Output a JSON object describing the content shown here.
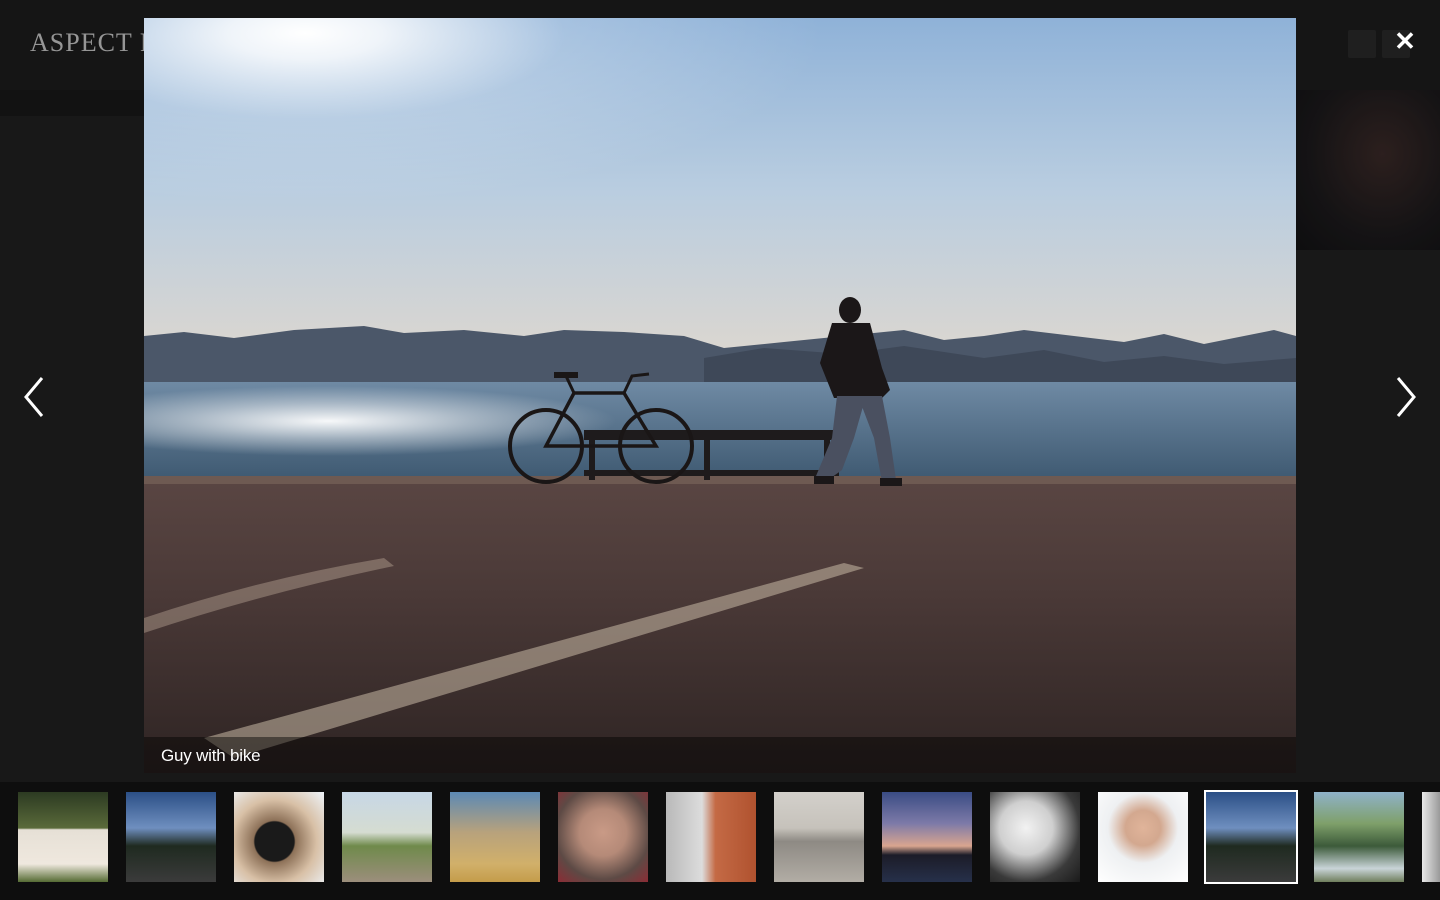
{
  "page": {
    "site_title": "ASPECT R"
  },
  "lightbox": {
    "caption": "Guy with bike",
    "close_glyph": "✕",
    "prev_icon": "chevron-left-icon",
    "next_icon": "chevron-right-icon"
  },
  "thumbnails": [
    {
      "name": "thumb-woman-dress"
    },
    {
      "name": "thumb-road-trees"
    },
    {
      "name": "thumb-camera"
    },
    {
      "name": "thumb-balloons"
    },
    {
      "name": "thumb-sunglasses-woman"
    },
    {
      "name": "thumb-splash-face"
    },
    {
      "name": "thumb-redhead-sunglasses"
    },
    {
      "name": "thumb-city-water"
    },
    {
      "name": "thumb-jump-silhouette"
    },
    {
      "name": "thumb-dancer"
    },
    {
      "name": "thumb-man-tie"
    },
    {
      "name": "thumb-road-trees-2"
    },
    {
      "name": "thumb-man-bench-river"
    },
    {
      "name": "thumb-partial"
    }
  ],
  "colors": {
    "overlay": "#101010",
    "caption_text": "#ffffff",
    "controls": "#ffffff"
  }
}
